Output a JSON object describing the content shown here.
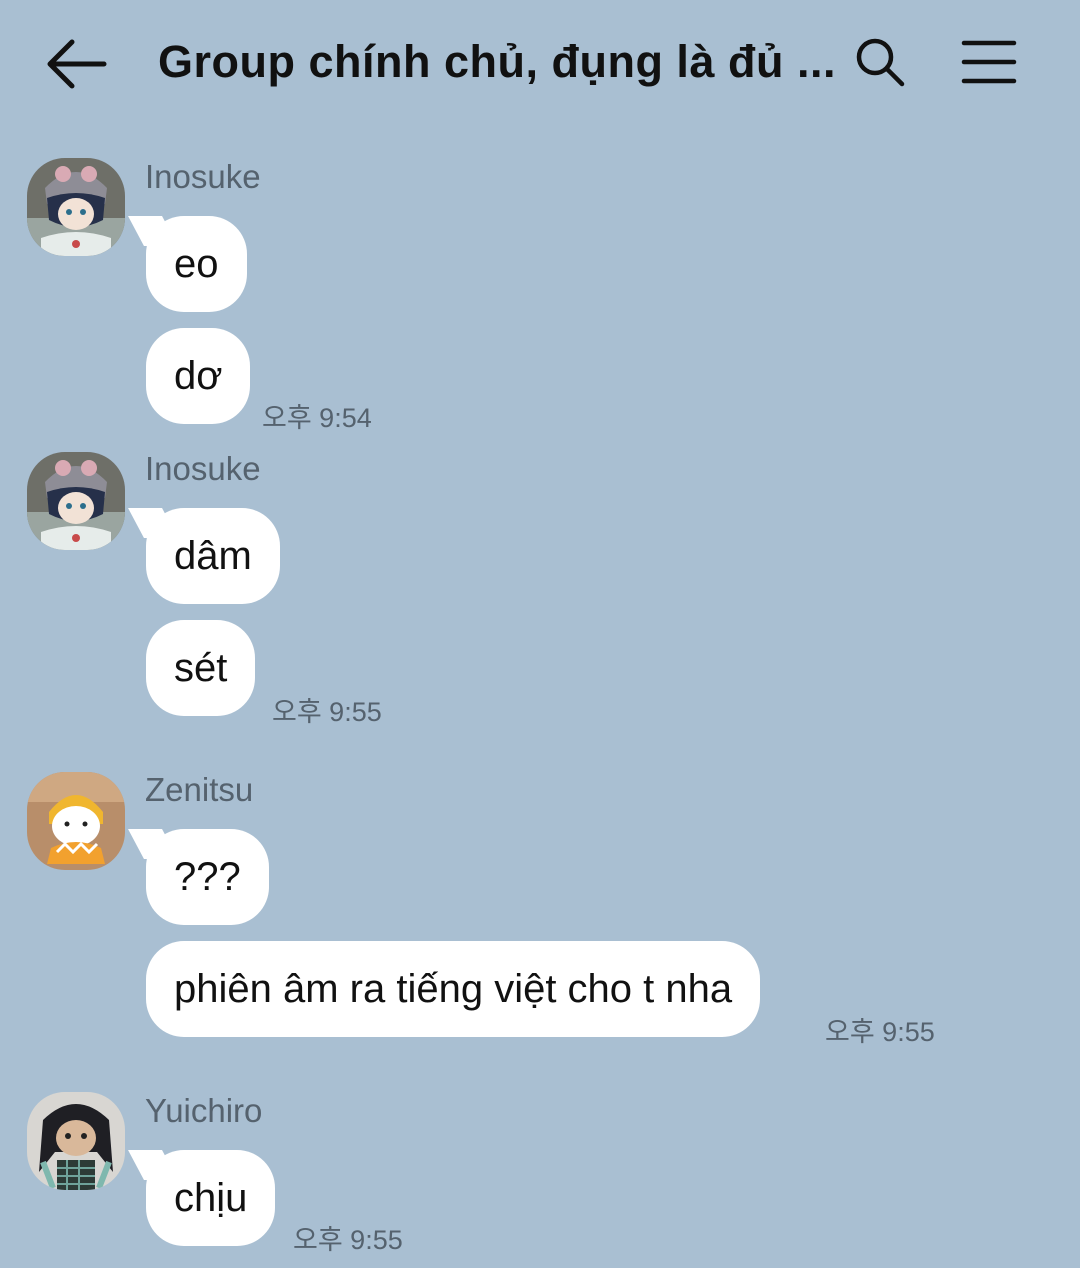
{
  "header": {
    "title": "Group chính chủ, đụng là đủ ..."
  },
  "messages": [
    {
      "sender": "Inosuke",
      "bubbles": [
        "eo",
        "dơ"
      ],
      "time": "오후 9:54"
    },
    {
      "sender": "Inosuke",
      "bubbles": [
        "dâm",
        "sét"
      ],
      "time": "오후 9:55"
    },
    {
      "sender": "Zenitsu",
      "bubbles": [
        "???",
        "phiên âm ra tiếng việt cho t nha"
      ],
      "time": "오후 9:55"
    },
    {
      "sender": "Yuichiro",
      "bubbles": [
        "chịu"
      ],
      "time": "오후 9:55"
    }
  ]
}
